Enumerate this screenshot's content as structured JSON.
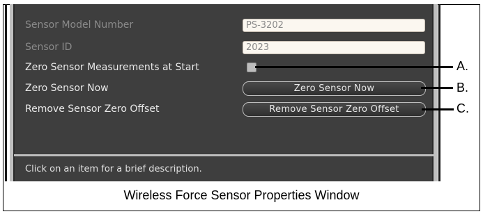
{
  "properties": {
    "model_number": {
      "label": "Sensor Model Number",
      "value": "PS-3202"
    },
    "sensor_id": {
      "label": "Sensor ID",
      "value": "2023"
    },
    "zero_at_start": {
      "label": "Zero Sensor Measurements at Start",
      "checked": false
    },
    "zero_now": {
      "label": "Zero Sensor Now",
      "button": "Zero Sensor Now"
    },
    "remove_offset": {
      "label": "Remove Sensor Zero Offset",
      "button": "Remove Sensor Zero Offset"
    }
  },
  "status_text": "Click on an item for a brief description.",
  "callouts": {
    "a": "A.",
    "b": "B.",
    "c": "C."
  },
  "caption": "Wireless Force Sensor Properties Window",
  "colors": {
    "panel": "#3e3e3e",
    "field_bg": "#fbf7f0",
    "button_border": "#bdbdbd"
  }
}
